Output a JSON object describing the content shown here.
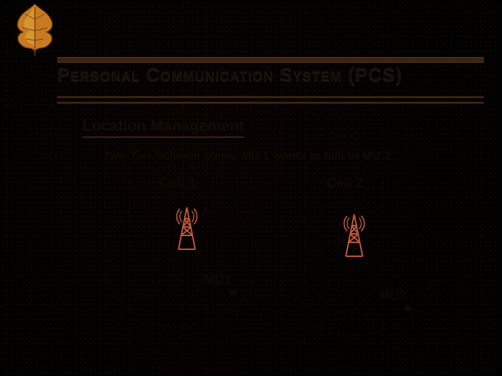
{
  "title": "Personal Communication System (PCS)",
  "section": "Location Management",
  "subtitle": "Two-Tier Scheme steps. MU 1 wants to talk to MU 2.",
  "cells": {
    "c1": "Cell 1",
    "c2": "Cell 2"
  },
  "mu": {
    "m1": "MU1",
    "m2": "MU2"
  },
  "colors": {
    "tower": "#c05a3a",
    "rule": "#3a2310"
  }
}
